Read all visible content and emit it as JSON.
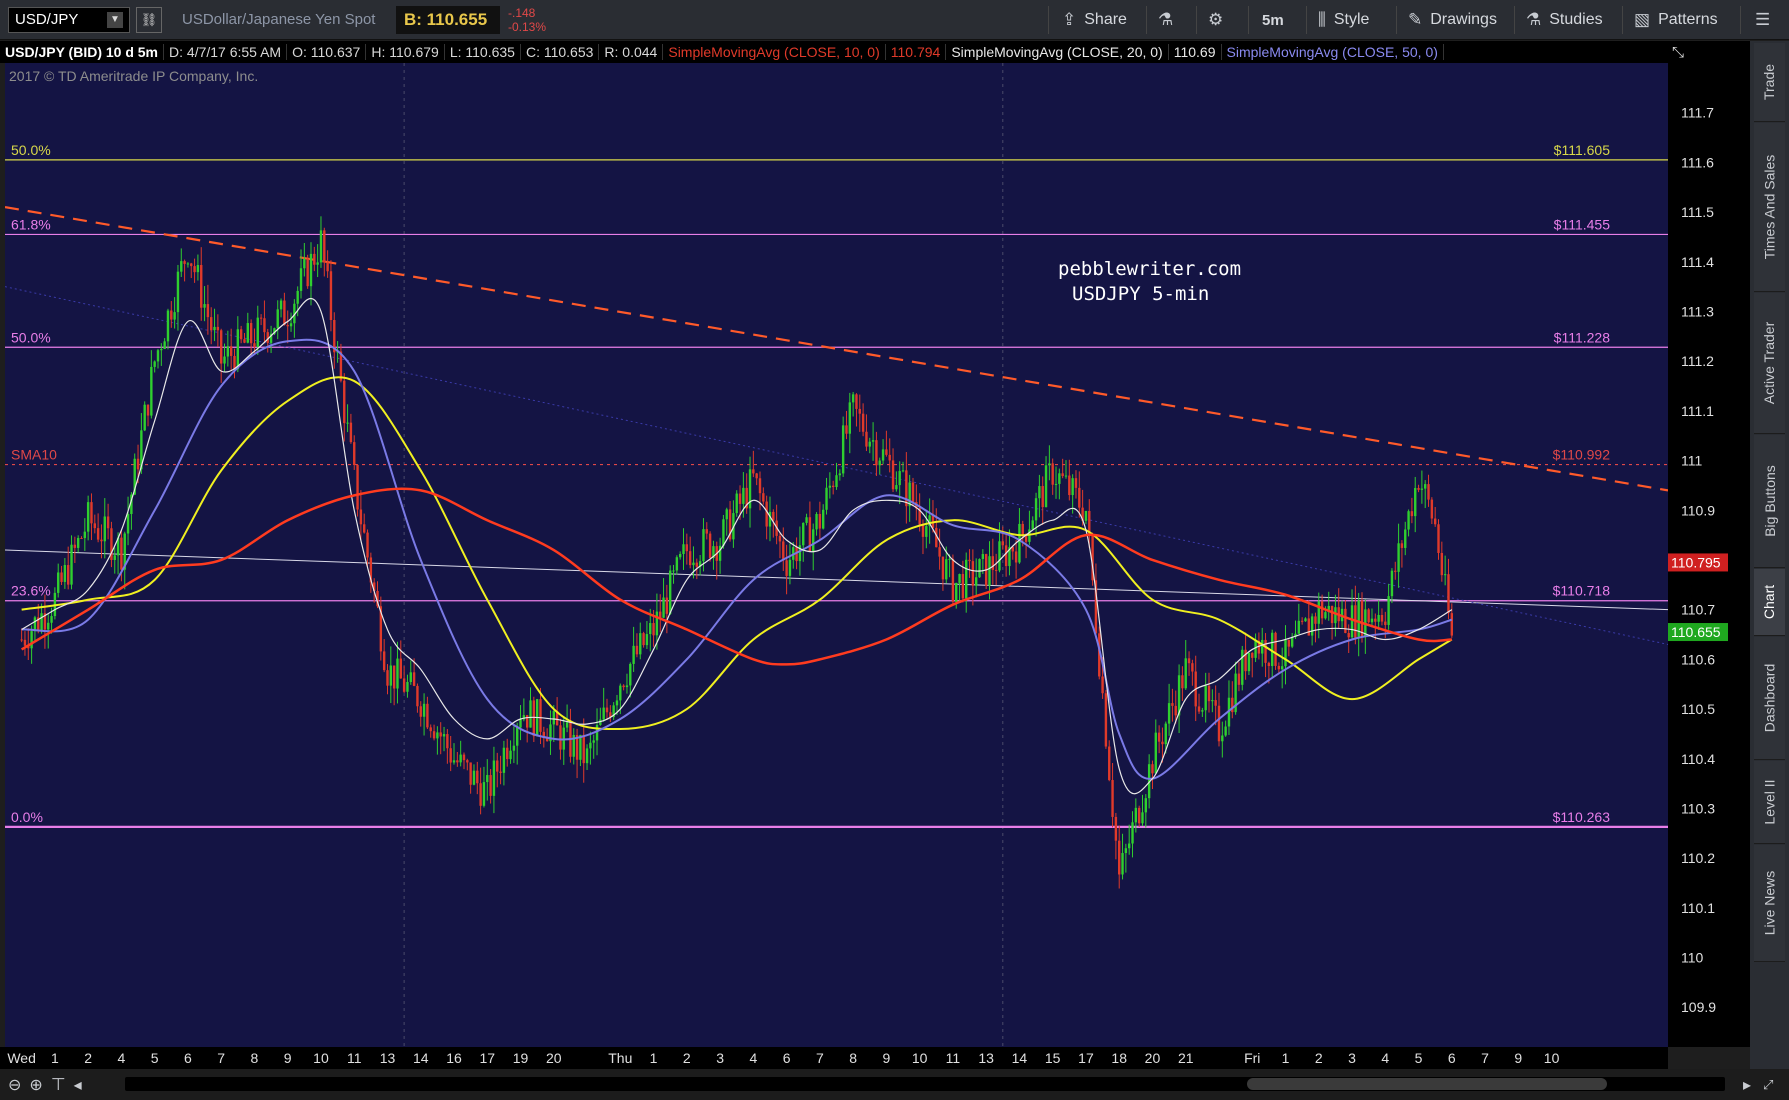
{
  "toolbar": {
    "symbol": "USD/JPY",
    "description": "USDollar/Japanese Yen Spot",
    "bid": "B: 110.655",
    "change": "-.148",
    "change_pct": "-0.13%",
    "share": "Share",
    "style": "Style",
    "drawings": "Drawings",
    "studies": "Studies",
    "patterns": "Patterns",
    "timeframe": "5m"
  },
  "infobar": {
    "title": "USD/JPY (BID) 10 d 5m",
    "date": "D: 4/7/17 6:55 AM",
    "open": "O: 110.637",
    "high": "H: 110.679",
    "low": "L: 110.635",
    "close": "C: 110.653",
    "range": "R: 0.044",
    "sma10": "SimpleMovingAvg (CLOSE, 10, 0)",
    "sma10_val": "110.794",
    "sma20": "SimpleMovingAvg (CLOSE, 20, 0)",
    "sma20_val": "110.69",
    "sma50": "SimpleMovingAvg (CLOSE, 50, 0)"
  },
  "copyright": "2017 © TD Ameritrade IP Company, Inc.",
  "watermark": {
    "line1": "pebblewriter.com",
    "line2": "USDJPY 5-min"
  },
  "sidetabs": [
    "Trade",
    "Times And Sales",
    "Active Trader",
    "Big Buttons",
    "Chart",
    "Dashboard",
    "Level II",
    "Live News"
  ],
  "colors": {
    "background": "#141444",
    "fib": "#e87ee8",
    "fib_top": "#d8d84a",
    "sma_red": "#ff3b1f",
    "sma_yellow": "#f0f020",
    "sma_blue": "#7a7ae6",
    "sma_white": "#e8e8e8",
    "trend": "#ff5a2a",
    "candle_up": "#2fcf2f",
    "candle_down": "#e03a2a"
  },
  "chart_data": {
    "type": "line",
    "title": "USD/JPY (BID) 10 d 5m",
    "ylim": [
      109.82,
      111.8
    ],
    "yticks": [
      "111.7",
      "111.6",
      "111.5",
      "111.4",
      "111.3",
      "111.2",
      "111.1",
      "111",
      "110.9",
      "110.8",
      "110.7",
      "110.6",
      "110.5",
      "110.4",
      "110.3",
      "110.2",
      "110.1",
      "110",
      "109.9"
    ],
    "xticks": [
      {
        "label": "Wed",
        "t": 0
      },
      {
        "label": "1",
        "t": 1
      },
      {
        "label": "2",
        "t": 2
      },
      {
        "label": "4",
        "t": 3
      },
      {
        "label": "5",
        "t": 4
      },
      {
        "label": "6",
        "t": 5
      },
      {
        "label": "7",
        "t": 6
      },
      {
        "label": "8",
        "t": 7
      },
      {
        "label": "9",
        "t": 8
      },
      {
        "label": "10",
        "t": 9
      },
      {
        "label": "11",
        "t": 10
      },
      {
        "label": "13",
        "t": 11
      },
      {
        "label": "14",
        "t": 12
      },
      {
        "label": "16",
        "t": 13
      },
      {
        "label": "17",
        "t": 14
      },
      {
        "label": "19",
        "t": 15
      },
      {
        "label": "20",
        "t": 16
      },
      {
        "label": "Thu",
        "t": 18
      },
      {
        "label": "1",
        "t": 19
      },
      {
        "label": "2",
        "t": 20
      },
      {
        "label": "3",
        "t": 21
      },
      {
        "label": "4",
        "t": 22
      },
      {
        "label": "6",
        "t": 23
      },
      {
        "label": "7",
        "t": 24
      },
      {
        "label": "8",
        "t": 25
      },
      {
        "label": "9",
        "t": 26
      },
      {
        "label": "10",
        "t": 27
      },
      {
        "label": "11",
        "t": 28
      },
      {
        "label": "13",
        "t": 29
      },
      {
        "label": "14",
        "t": 30
      },
      {
        "label": "15",
        "t": 31
      },
      {
        "label": "17",
        "t": 32
      },
      {
        "label": "18",
        "t": 33
      },
      {
        "label": "20",
        "t": 34
      },
      {
        "label": "21",
        "t": 35
      },
      {
        "label": "Fri",
        "t": 37
      },
      {
        "label": "1",
        "t": 38
      },
      {
        "label": "2",
        "t": 39
      },
      {
        "label": "3",
        "t": 40
      },
      {
        "label": "4",
        "t": 41
      },
      {
        "label": "5",
        "t": 42
      },
      {
        "label": "6",
        "t": 43
      },
      {
        "label": "7",
        "t": 44
      },
      {
        "label": "9",
        "t": 45
      },
      {
        "label": "10",
        "t": 46
      }
    ],
    "xlim": [
      -0.5,
      49.5
    ],
    "fib_levels": [
      {
        "label": "50.0%",
        "price": 111.605,
        "value": "$111.605",
        "color": "#d8d84a"
      },
      {
        "label": "61.8%",
        "price": 111.455,
        "value": "$111.455",
        "color": "#e87ee8"
      },
      {
        "label": "50.0%",
        "price": 111.228,
        "value": "$111.228",
        "color": "#e87ee8"
      },
      {
        "label": "SMA10",
        "price": 110.992,
        "value": "$110.992",
        "color": "#e04848",
        "dashed": true
      },
      {
        "label": "23.6%",
        "price": 110.718,
        "value": "$110.718",
        "color": "#e87ee8"
      },
      {
        "label": "0.0%",
        "price": 110.263,
        "value": "$110.263",
        "color": "#e87ee8",
        "thick": true
      }
    ],
    "price_badges": [
      {
        "value": "110.795",
        "price": 110.795,
        "color": "#d02020"
      },
      {
        "value": "110.655",
        "price": 110.655,
        "color": "#1fa81f"
      }
    ],
    "trendlines": [
      {
        "name": "red-dashed",
        "points": [
          [
            -0.5,
            111.51
          ],
          [
            49.5,
            110.94
          ]
        ]
      },
      {
        "name": "white",
        "points": [
          [
            -0.5,
            110.82
          ],
          [
            49.5,
            110.7
          ]
        ]
      },
      {
        "name": "blue-faint",
        "points": [
          [
            -0.5,
            111.35
          ],
          [
            49.5,
            110.63
          ]
        ]
      }
    ],
    "series": [
      {
        "name": "SimpleMovingAvg (CLOSE, 10, 0)",
        "color": "#ff3b1f",
        "width": 2.5,
        "points": [
          [
            0,
            110.62
          ],
          [
            2,
            110.7
          ],
          [
            4,
            110.78
          ],
          [
            6,
            110.8
          ],
          [
            8,
            110.88
          ],
          [
            10,
            110.93
          ],
          [
            12,
            110.94
          ],
          [
            14,
            110.88
          ],
          [
            16,
            110.82
          ],
          [
            18,
            110.72
          ],
          [
            20,
            110.66
          ],
          [
            22,
            110.6
          ],
          [
            23,
            110.59
          ],
          [
            24,
            110.6
          ],
          [
            26,
            110.64
          ],
          [
            28,
            110.71
          ],
          [
            30,
            110.76
          ],
          [
            32,
            110.85
          ],
          [
            34,
            110.8
          ],
          [
            36,
            110.76
          ],
          [
            38,
            110.73
          ],
          [
            40,
            110.68
          ],
          [
            42,
            110.64
          ],
          [
            43,
            110.64
          ]
        ]
      },
      {
        "name": "SimpleMovingAvg (CLOSE, 50, 0)",
        "color": "#f0f020",
        "width": 2,
        "points": [
          [
            0,
            110.7
          ],
          [
            2,
            110.72
          ],
          [
            4,
            110.76
          ],
          [
            6,
            110.98
          ],
          [
            8,
            111.12
          ],
          [
            10,
            111.16
          ],
          [
            12,
            110.98
          ],
          [
            14,
            110.72
          ],
          [
            16,
            110.5
          ],
          [
            18,
            110.46
          ],
          [
            20,
            110.5
          ],
          [
            22,
            110.64
          ],
          [
            24,
            110.72
          ],
          [
            26,
            110.84
          ],
          [
            28,
            110.88
          ],
          [
            30,
            110.85
          ],
          [
            32,
            110.86
          ],
          [
            34,
            110.72
          ],
          [
            36,
            110.68
          ],
          [
            38,
            110.6
          ],
          [
            40,
            110.52
          ],
          [
            42,
            110.6
          ],
          [
            43,
            110.64
          ]
        ]
      },
      {
        "name": "blue-average",
        "color": "#7a7ae6",
        "width": 2,
        "points": [
          [
            0,
            110.66
          ],
          [
            2,
            110.68
          ],
          [
            4,
            110.9
          ],
          [
            6,
            111.15
          ],
          [
            8,
            111.24
          ],
          [
            10,
            111.18
          ],
          [
            12,
            110.8
          ],
          [
            14,
            110.52
          ],
          [
            16,
            110.44
          ],
          [
            18,
            110.48
          ],
          [
            20,
            110.6
          ],
          [
            22,
            110.76
          ],
          [
            24,
            110.84
          ],
          [
            26,
            110.93
          ],
          [
            28,
            110.87
          ],
          [
            30,
            110.84
          ],
          [
            32,
            110.7
          ],
          [
            33,
            110.45
          ],
          [
            34,
            110.36
          ],
          [
            36,
            110.48
          ],
          [
            38,
            110.58
          ],
          [
            40,
            110.64
          ],
          [
            42,
            110.66
          ],
          [
            43,
            110.68
          ]
        ]
      },
      {
        "name": "SimpleMovingAvg (CLOSE, 20, 0)",
        "color": "#e8e8e8",
        "width": 1.2,
        "points": [
          [
            0,
            110.66
          ],
          [
            1,
            110.7
          ],
          [
            2,
            110.74
          ],
          [
            3,
            110.86
          ],
          [
            4,
            111.08
          ],
          [
            5,
            111.28
          ],
          [
            6,
            111.18
          ],
          [
            7,
            111.22
          ],
          [
            8,
            111.28
          ],
          [
            9,
            111.3
          ],
          [
            10,
            110.9
          ],
          [
            11,
            110.66
          ],
          [
            12,
            110.58
          ],
          [
            13,
            110.48
          ],
          [
            14,
            110.44
          ],
          [
            15,
            110.48
          ],
          [
            16,
            110.48
          ],
          [
            17,
            110.47
          ],
          [
            18,
            110.5
          ],
          [
            19,
            110.62
          ],
          [
            20,
            110.76
          ],
          [
            21,
            110.82
          ],
          [
            22,
            110.92
          ],
          [
            23,
            110.84
          ],
          [
            24,
            110.82
          ],
          [
            25,
            110.9
          ],
          [
            26,
            110.92
          ],
          [
            27,
            110.9
          ],
          [
            28,
            110.8
          ],
          [
            29,
            110.78
          ],
          [
            30,
            110.84
          ],
          [
            31,
            110.88
          ],
          [
            32,
            110.86
          ],
          [
            33,
            110.38
          ],
          [
            34,
            110.36
          ],
          [
            35,
            110.52
          ],
          [
            36,
            110.56
          ],
          [
            37,
            110.62
          ],
          [
            38,
            110.64
          ],
          [
            39,
            110.66
          ],
          [
            40,
            110.66
          ],
          [
            41,
            110.64
          ],
          [
            42,
            110.66
          ],
          [
            43,
            110.7
          ]
        ]
      },
      {
        "name": "price",
        "color": "#d84a2a",
        "width": 1.2,
        "points": [
          [
            0,
            110.64
          ],
          [
            1,
            110.72
          ],
          [
            2,
            110.88
          ],
          [
            3,
            110.82
          ],
          [
            4,
            111.2
          ],
          [
            5,
            111.43
          ],
          [
            6,
            111.2
          ],
          [
            7,
            111.25
          ],
          [
            8,
            111.3
          ],
          [
            9,
            111.44
          ],
          [
            10,
            110.96
          ],
          [
            11,
            110.58
          ],
          [
            12,
            110.52
          ],
          [
            13,
            110.4
          ],
          [
            14,
            110.33
          ],
          [
            15,
            110.5
          ],
          [
            16,
            110.46
          ],
          [
            17,
            110.4
          ],
          [
            18,
            110.56
          ],
          [
            19,
            110.66
          ],
          [
            20,
            110.82
          ],
          [
            21,
            110.84
          ],
          [
            22,
            110.96
          ],
          [
            23,
            110.8
          ],
          [
            24,
            110.88
          ],
          [
            25,
            111.1
          ],
          [
            26,
            111.0
          ],
          [
            27,
            110.9
          ],
          [
            28,
            110.75
          ],
          [
            29,
            110.78
          ],
          [
            30,
            110.84
          ],
          [
            31,
            110.98
          ],
          [
            32,
            110.9
          ],
          [
            33,
            110.16
          ],
          [
            34,
            110.4
          ],
          [
            35,
            110.58
          ],
          [
            36,
            110.46
          ],
          [
            37,
            110.64
          ],
          [
            38,
            110.6
          ],
          [
            39,
            110.7
          ],
          [
            40,
            110.68
          ],
          [
            41,
            110.7
          ],
          [
            42,
            110.97
          ],
          [
            42.5,
            110.87
          ],
          [
            43,
            110.64
          ]
        ]
      }
    ]
  }
}
